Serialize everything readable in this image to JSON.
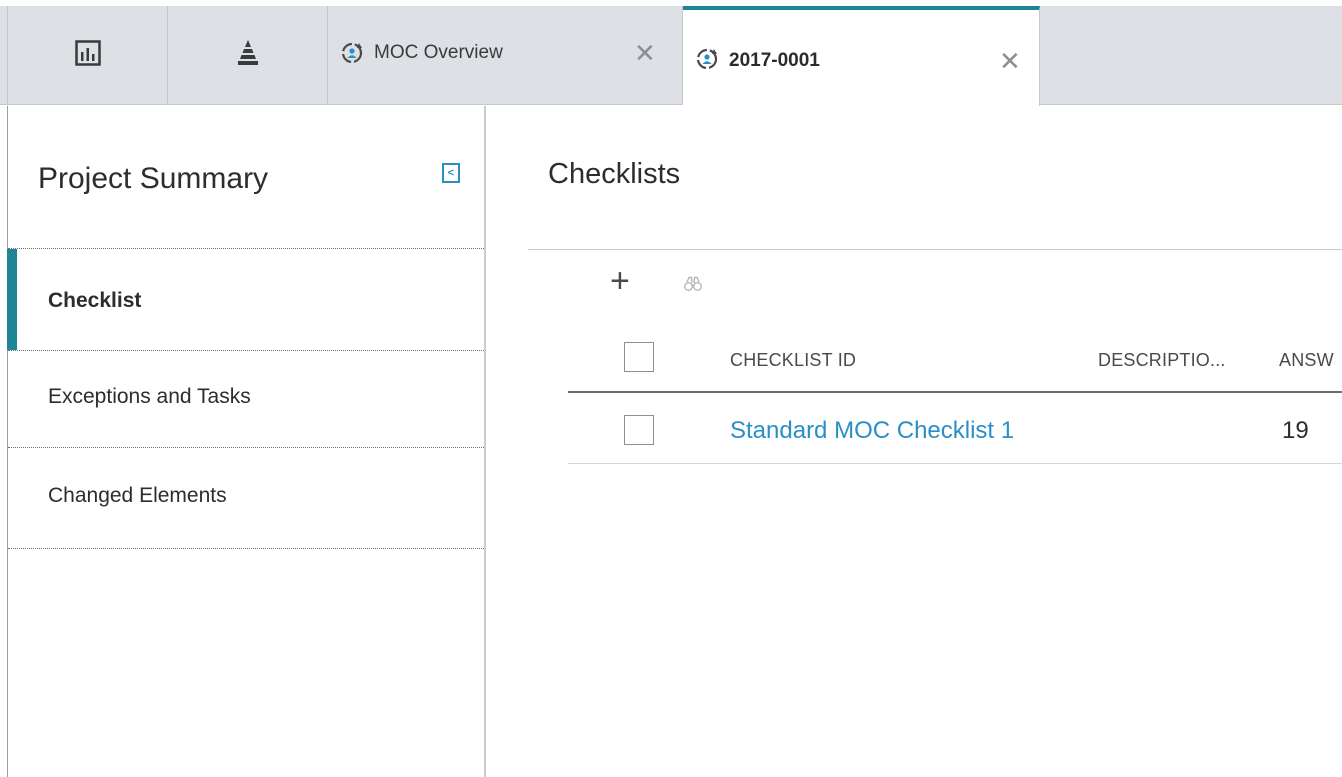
{
  "tabs": {
    "icon_tab_1": {
      "icon": "dashboard-chart-icon"
    },
    "icon_tab_2": {
      "icon": "pyramid-icon"
    },
    "moc_overview": {
      "label": "MOC Overview",
      "icon": "moc-cycle-icon",
      "close_icon": "close-icon",
      "close_glyph": "✕"
    },
    "record": {
      "label": "2017-0001",
      "icon": "moc-cycle-icon",
      "close_icon": "close-icon",
      "close_glyph": "✕",
      "active": true
    }
  },
  "sidebar": {
    "title": "Project Summary",
    "collapse_glyph": "<",
    "items": [
      {
        "label": "Checklist",
        "active": true
      },
      {
        "label": "Exceptions and Tasks",
        "active": false
      },
      {
        "label": "Changed Elements",
        "active": false
      }
    ]
  },
  "main": {
    "title": "Checklists",
    "toolbar": {
      "add_glyph": "+",
      "add_icon": "add-icon",
      "search_icon": "binoculars-icon"
    },
    "columns": [
      "CHECKLIST ID",
      "DESCRIPTIO...",
      "ANSW"
    ],
    "rows": [
      {
        "checklist_id": "Standard MOC Checklist 1",
        "description": "",
        "answered": "19"
      }
    ]
  },
  "colors": {
    "accent_teal": "#1e8597",
    "link_blue": "#2a8fc7",
    "tabbar_bg": "#dde1e5"
  }
}
